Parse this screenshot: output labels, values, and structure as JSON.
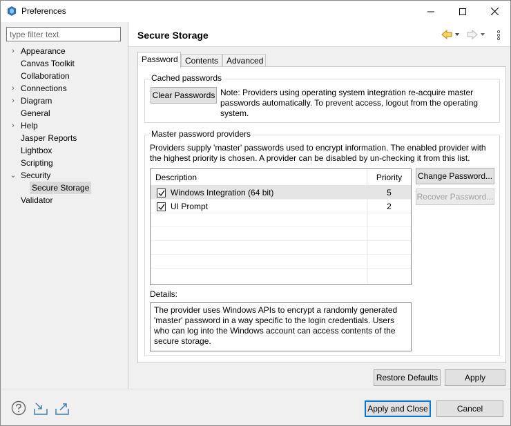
{
  "window": {
    "title": "Preferences",
    "minimize_glyph": "—",
    "maximize_glyph": "☐",
    "close_glyph": "✕"
  },
  "sidebar": {
    "filter_placeholder": "type filter text",
    "items": [
      {
        "label": "Appearance",
        "expandable": true
      },
      {
        "label": "Canvas Toolkit",
        "expandable": false
      },
      {
        "label": "Collaboration",
        "expandable": false
      },
      {
        "label": "Connections",
        "expandable": true
      },
      {
        "label": "Diagram",
        "expandable": true
      },
      {
        "label": "General",
        "expandable": false
      },
      {
        "label": "Help",
        "expandable": true
      },
      {
        "label": "Jasper Reports",
        "expandable": false
      },
      {
        "label": "Lightbox",
        "expandable": false
      },
      {
        "label": "Scripting",
        "expandable": false
      },
      {
        "label": "Security",
        "expandable": true,
        "expanded": true
      },
      {
        "label": "Secure Storage",
        "child": true,
        "selected": true
      },
      {
        "label": "Validator",
        "expandable": false
      }
    ]
  },
  "page": {
    "title": "Secure Storage"
  },
  "tabs": [
    {
      "label": "Password",
      "active": true
    },
    {
      "label": "Contents",
      "active": false
    },
    {
      "label": "Advanced",
      "active": false
    }
  ],
  "cached": {
    "group_title": "Cached passwords",
    "clear_button": "Clear Passwords",
    "note_line1": "Note: Providers using operating system integration re-acquire master",
    "note_line2": "passwords automatically. To prevent access, logout from the operating",
    "note_line3": "system."
  },
  "providers": {
    "group_title": "Master password providers",
    "desc_line1": "Providers supply 'master' passwords used to encrypt information. The enabled provider with",
    "desc_line2": "the highest priority is chosen. A provider can be disabled by un-checking it from this list.",
    "columns": {
      "description": "Description",
      "priority": "Priority"
    },
    "rows": [
      {
        "description": "Windows Integration (64 bit)",
        "priority": "5",
        "checked": true,
        "selected": true
      },
      {
        "description": "UI Prompt",
        "priority": "2",
        "checked": true,
        "selected": false
      }
    ],
    "change_button": "Change Password...",
    "recover_button": "Recover Password...",
    "details_label": "Details:",
    "details_line1": "The provider uses Windows APIs to encrypt a randomly generated",
    "details_line2": "'master' password in a way specific to the login credentials. Users",
    "details_line3": "who can log into the Windows account can access contents of the",
    "details_line4": "secure storage."
  },
  "footer": {
    "restore_defaults": "Restore Defaults",
    "apply": "Apply",
    "apply_and_close": "Apply and Close",
    "cancel": "Cancel"
  },
  "colors": {
    "accent": "#0078d7",
    "app_icon": "#2a6ebb"
  }
}
